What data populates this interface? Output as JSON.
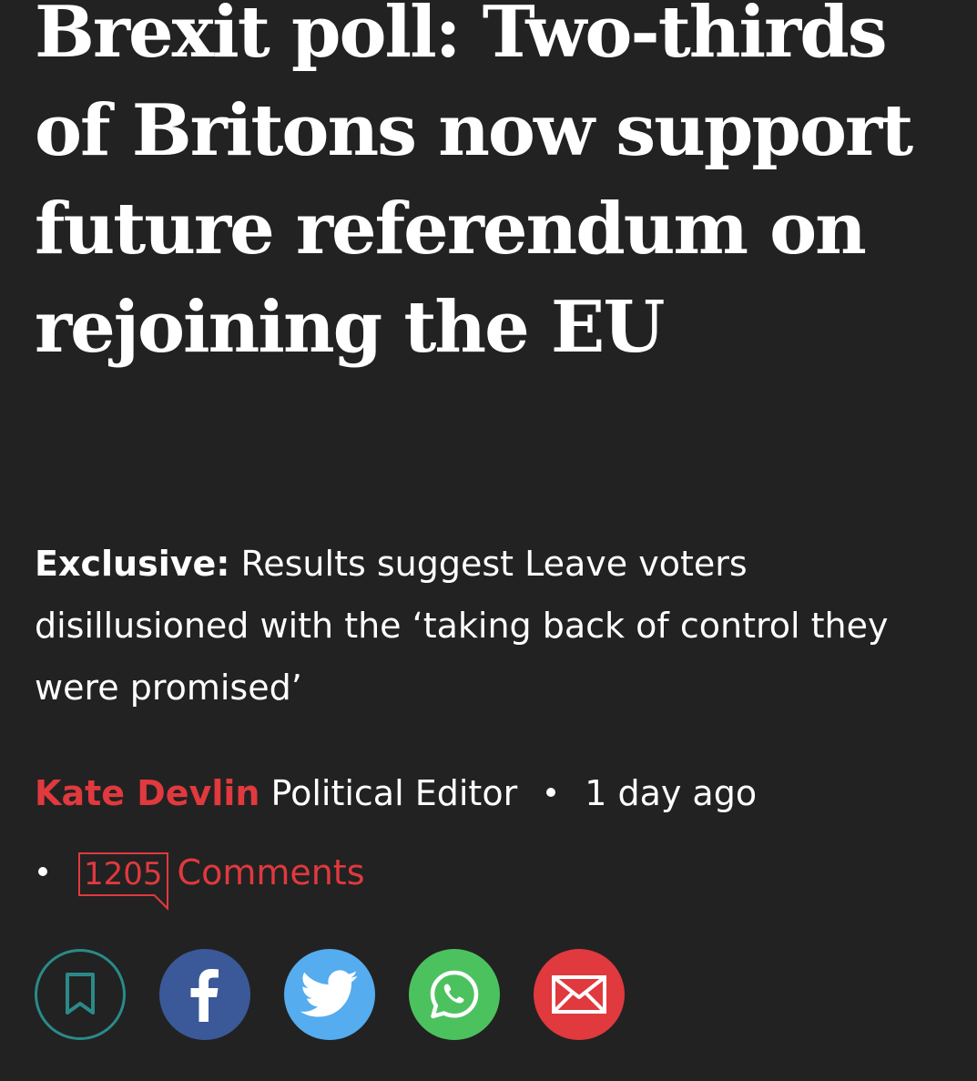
{
  "article": {
    "headline": "Brexit poll: Two-thirds of Britons now support future referendum on rejoining the EU",
    "standfirst_label": "Exclusive:",
    "standfirst_text": " Results suggest Leave voters disillusioned with the ‘taking back of control they were promised’",
    "author": "Kate Devlin",
    "author_role": " Political Editor",
    "published": "1 day ago",
    "comment_count": "1205",
    "comments_label": "Comments"
  },
  "share": {
    "buttons": [
      {
        "name": "bookmark",
        "icon": "bookmark-icon",
        "color": "#2a8a8a"
      },
      {
        "name": "facebook",
        "icon": "facebook-icon",
        "color": "#3b5998"
      },
      {
        "name": "twitter",
        "icon": "twitter-icon",
        "color": "#55acee"
      },
      {
        "name": "whatsapp",
        "icon": "whatsapp-icon",
        "color": "#4cc25f"
      },
      {
        "name": "email",
        "icon": "email-icon",
        "color": "#e0393e"
      }
    ]
  },
  "colors": {
    "background": "#222222",
    "accent": "#e0393e",
    "text": "#ffffff"
  }
}
